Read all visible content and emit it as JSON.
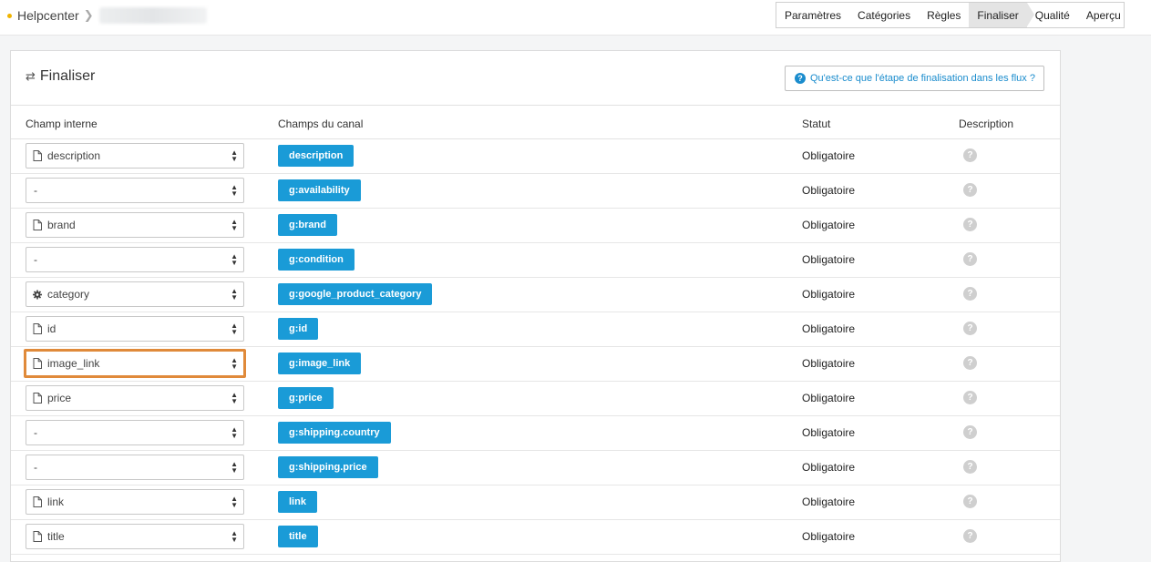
{
  "breadcrumb": {
    "root": "Helpcenter"
  },
  "steps": [
    {
      "label": "Paramètres",
      "active": false
    },
    {
      "label": "Catégories",
      "active": false
    },
    {
      "label": "Règles",
      "active": false
    },
    {
      "label": "Finaliser",
      "active": true
    },
    {
      "label": "Qualité",
      "active": false
    },
    {
      "label": "Aperçu",
      "active": false
    }
  ],
  "panel": {
    "title": "Finaliser",
    "help_button": "Qu'est-ce que l'étape de finalisation dans les flux ?"
  },
  "columns": {
    "internal": "Champ interne",
    "channel": "Champs du canal",
    "status": "Statut",
    "description": "Description"
  },
  "colors": {
    "accent": "#1a9bd7",
    "highlight": "#e08a3a"
  },
  "rows": [
    {
      "internal": "description",
      "icon": "file-icon",
      "channel": "description",
      "status": "Obligatoire"
    },
    {
      "internal": "-",
      "icon": "",
      "channel": "g:availability",
      "status": "Obligatoire"
    },
    {
      "internal": "brand",
      "icon": "file-icon",
      "channel": "g:brand",
      "status": "Obligatoire"
    },
    {
      "internal": "-",
      "icon": "",
      "channel": "g:condition",
      "status": "Obligatoire"
    },
    {
      "internal": "category",
      "icon": "gear-icon",
      "channel": "g:google_product_category",
      "status": "Obligatoire"
    },
    {
      "internal": "id",
      "icon": "file-icon",
      "channel": "g:id",
      "status": "Obligatoire"
    },
    {
      "internal": "image_link",
      "icon": "file-icon",
      "channel": "g:image_link",
      "status": "Obligatoire",
      "highlighted": true
    },
    {
      "internal": "price",
      "icon": "file-icon",
      "channel": "g:price",
      "status": "Obligatoire"
    },
    {
      "internal": "-",
      "icon": "",
      "channel": "g:shipping.country",
      "status": "Obligatoire"
    },
    {
      "internal": "-",
      "icon": "",
      "channel": "g:shipping.price",
      "status": "Obligatoire"
    },
    {
      "internal": "link",
      "icon": "file-icon",
      "channel": "link",
      "status": "Obligatoire"
    },
    {
      "internal": "title",
      "icon": "file-icon",
      "channel": "title",
      "status": "Obligatoire"
    }
  ]
}
